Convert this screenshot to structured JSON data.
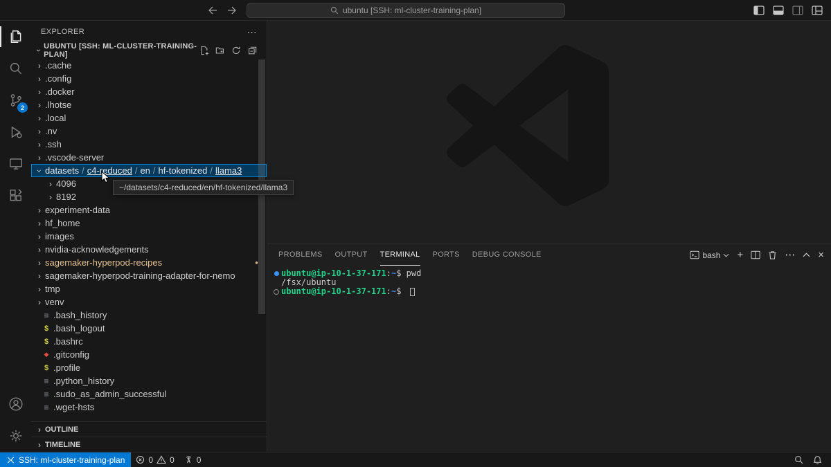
{
  "title_bar": {
    "command_center": "ubuntu [SSH: ml-cluster-training-plan]"
  },
  "activity_bar": {
    "source_control_badge": "2"
  },
  "sidebar": {
    "header": "EXPLORER",
    "section_title": "UBUNTU [SSH: ML-CLUSTER-TRAINING-PLAN]",
    "tooltip": "~/datasets/c4-reduced/en/hf-tokenized/llama3",
    "outline": "OUTLINE",
    "timeline": "TIMELINE",
    "tree": [
      {
        "label": ".cache",
        "kind": "folder",
        "chevron": "right"
      },
      {
        "label": ".config",
        "kind": "folder",
        "chevron": "right"
      },
      {
        "label": ".docker",
        "kind": "folder",
        "chevron": "right"
      },
      {
        "label": ".lhotse",
        "kind": "folder",
        "chevron": "right"
      },
      {
        "label": ".local",
        "kind": "folder",
        "chevron": "right"
      },
      {
        "label": ".nv",
        "kind": "folder",
        "chevron": "right"
      },
      {
        "label": ".ssh",
        "kind": "folder",
        "chevron": "right"
      },
      {
        "label": ".vscode-server",
        "kind": "folder",
        "chevron": "right"
      },
      {
        "kind": "folder",
        "chevron": "down",
        "selected": true,
        "segments": [
          "datasets",
          "c4-reduced",
          "en",
          "hf-tokenized",
          "llama3"
        ],
        "underline": [
          1,
          4
        ]
      },
      {
        "label": "4096",
        "kind": "folder",
        "chevron": "right",
        "indent": 1
      },
      {
        "label": "8192",
        "kind": "folder",
        "chevron": "right",
        "indent": 1
      },
      {
        "label": "experiment-data",
        "kind": "folder",
        "chevron": "right"
      },
      {
        "label": "hf_home",
        "kind": "folder",
        "chevron": "right"
      },
      {
        "label": "images",
        "kind": "folder",
        "chevron": "right"
      },
      {
        "label": "nvidia-acknowledgements",
        "kind": "folder",
        "chevron": "right"
      },
      {
        "label": "sagemaker-hyperpod-recipes",
        "kind": "folder",
        "chevron": "right",
        "modified": true,
        "badge": "●"
      },
      {
        "label": "sagemaker-hyperpod-training-adapter-for-nemo",
        "kind": "folder",
        "chevron": "right"
      },
      {
        "label": "tmp",
        "kind": "folder",
        "chevron": "right"
      },
      {
        "label": "venv",
        "kind": "folder",
        "chevron": "right"
      },
      {
        "label": ".bash_history",
        "kind": "file",
        "icon": "text"
      },
      {
        "label": ".bash_logout",
        "kind": "file",
        "icon": "shell"
      },
      {
        "label": ".bashrc",
        "kind": "file",
        "icon": "shell"
      },
      {
        "label": ".gitconfig",
        "kind": "file",
        "icon": "git"
      },
      {
        "label": ".profile",
        "kind": "file",
        "icon": "shell"
      },
      {
        "label": ".python_history",
        "kind": "file",
        "icon": "text"
      },
      {
        "label": ".sudo_as_admin_successful",
        "kind": "file",
        "icon": "text"
      },
      {
        "label": ".wget-hsts",
        "kind": "file",
        "icon": "text"
      }
    ]
  },
  "panel": {
    "tabs": [
      {
        "label": "PROBLEMS"
      },
      {
        "label": "OUTPUT"
      },
      {
        "label": "TERMINAL",
        "active": true
      },
      {
        "label": "PORTS"
      },
      {
        "label": "DEBUG CONSOLE"
      }
    ],
    "shell_label": "bash",
    "terminal": {
      "lines": [
        {
          "deco": "filled",
          "prompt": {
            "user": "ubuntu@ip-10-1-37-171",
            "sep": ":",
            "path": "~",
            "dollar": "$"
          },
          "command": "pwd"
        },
        {
          "output": "/fsx/ubuntu"
        },
        {
          "deco": "hollow",
          "prompt": {
            "user": "ubuntu@ip-10-1-37-171",
            "sep": ":",
            "path": "~",
            "dollar": "$"
          },
          "command": "",
          "cursor": true
        }
      ]
    }
  },
  "status_bar": {
    "remote": "SSH: ml-cluster-training-plan",
    "errors": "0",
    "warnings": "0",
    "ports": "0"
  },
  "icons": {
    "chevron": "›",
    "more": "⋯",
    "plus": "+",
    "close": "×",
    "path_separator": "/",
    "file_text": "≡",
    "file_shell": "$",
    "file_git": "◆"
  },
  "colors": {
    "accent_blue": "#0078d4",
    "selection_background": "#04395e",
    "selection_border": "#007fd4",
    "git_modified": "#e2c08d",
    "terminal_green": "#23d18b",
    "terminal_blue": "#3b8eea",
    "badge_blue": "#0078d4"
  }
}
